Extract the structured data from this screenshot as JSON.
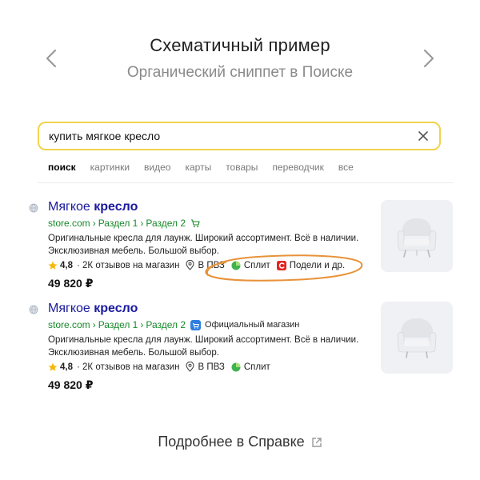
{
  "header": {
    "title": "Схематичный пример",
    "subtitle": "Органический сниппет в Поиске"
  },
  "search": {
    "query": "купить мягкое кресло"
  },
  "tabs": [
    {
      "label": "поиск",
      "active": true
    },
    {
      "label": "картинки",
      "active": false
    },
    {
      "label": "видео",
      "active": false
    },
    {
      "label": "карты",
      "active": false
    },
    {
      "label": "товары",
      "active": false
    },
    {
      "label": "переводчик",
      "active": false
    },
    {
      "label": "все",
      "active": false
    }
  ],
  "results": [
    {
      "title_plain": "Мягкое",
      "title_bold": "кресло",
      "url_domain": "store.com",
      "url_part1": "Раздел 1",
      "url_part2": "Раздел 2",
      "url_sep": "›",
      "description_line1": "Оригинальные кресла для лаунж. Широкий ассортимент. Всё в наличии.",
      "description_line2": "Эксклюзивная мебель. Большой выбор.",
      "rating": "4,8",
      "reviews": "· 2К отзывов на магазин",
      "pickup": "В ПВЗ",
      "split": "Сплит",
      "share": "Подели и др.",
      "price": "49 820 ₽"
    },
    {
      "title_plain": "Мягкое",
      "title_bold": "кресло",
      "url_domain": "store.com",
      "url_part1": "Раздел 1",
      "url_part2": "Раздел 2",
      "url_sep": "›",
      "official": "Официальный магазин",
      "description_line1": "Оригинальные кресла для лаунж. Широкий ассортимент. Всё в наличии.",
      "description_line2": "Эксклюзивная мебель. Большой выбор.",
      "rating": "4,8",
      "reviews": "· 2К отзывов на магазин",
      "pickup": "В ПВЗ",
      "split": "Сплит",
      "price": "49 820 ₽"
    }
  ],
  "footer": {
    "link": "Подробнее в Справке"
  },
  "colors": {
    "search_border": "#f2d34c",
    "title_link": "#1a1a9e",
    "url_green": "#168a2a",
    "highlight": "#e8923a"
  },
  "icons": [
    "chevron-left-icon",
    "chevron-right-icon",
    "clear-icon",
    "globe-icon",
    "cart-icon",
    "star-icon",
    "pin-icon",
    "split-icon",
    "share-icon",
    "official-badge-icon",
    "chair-icon",
    "external-link-icon"
  ]
}
